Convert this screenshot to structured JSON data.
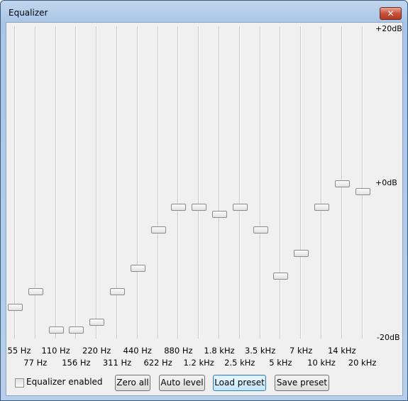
{
  "window": {
    "title": "Equalizer",
    "close_icon": "close-x-icon"
  },
  "scale": {
    "top": "+20dB",
    "middle": "+0dB",
    "bottom": "-20dB"
  },
  "bands": [
    {
      "label": "55 Hz",
      "gain_db": -16
    },
    {
      "label": "77 Hz",
      "gain_db": -14
    },
    {
      "label": "110 Hz",
      "gain_db": -19
    },
    {
      "label": "156 Hz",
      "gain_db": -19
    },
    {
      "label": "220 Hz",
      "gain_db": -18
    },
    {
      "label": "311 Hz",
      "gain_db": -14
    },
    {
      "label": "440 Hz",
      "gain_db": -11
    },
    {
      "label": "622 Hz",
      "gain_db": -6
    },
    {
      "label": "880 Hz",
      "gain_db": -3
    },
    {
      "label": "1.2 kHz",
      "gain_db": -3
    },
    {
      "label": "1.8 kHz",
      "gain_db": -4
    },
    {
      "label": "2.5 kHz",
      "gain_db": -3
    },
    {
      "label": "3.5 kHz",
      "gain_db": -6
    },
    {
      "label": "5 kHz",
      "gain_db": -12
    },
    {
      "label": "7 kHz",
      "gain_db": -9
    },
    {
      "label": "10 kHz",
      "gain_db": -3
    },
    {
      "label": "14 kHz",
      "gain_db": 0
    },
    {
      "label": "20 kHz",
      "gain_db": -1
    }
  ],
  "controls": {
    "enabled_label": "Equalizer enabled",
    "enabled": false,
    "zero_all": "Zero all",
    "auto_level": "Auto level",
    "load_preset": "Load preset",
    "save_preset": "Save preset"
  }
}
